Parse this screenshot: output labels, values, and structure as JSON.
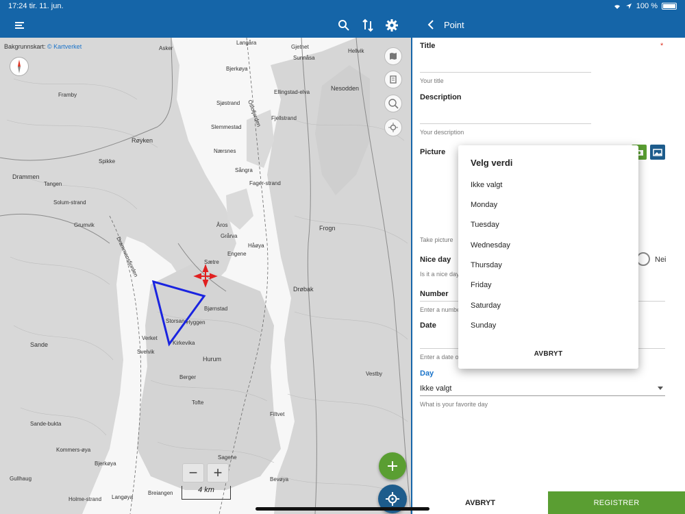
{
  "status_bar": {
    "time": "17:24",
    "date": "tir. 11. jun.",
    "battery": "100 %"
  },
  "map": {
    "attribution": "Bakgrunnskart:",
    "attribution_link": "© Kartverket",
    "scale_label": "4 km",
    "zoom_in": "+",
    "zoom_out": "−",
    "labels": [
      "Asker",
      "Langåra",
      "Gjetnet",
      "Hellvik",
      "Sunnåsa",
      "Nesodden",
      "Framby",
      "Bjerkøya",
      "Ellingstad-elva",
      "Sjøstrand",
      "Slemmestad",
      "Røyken",
      "Spikke",
      "Nærsnes",
      "Sångra",
      "Fjellstrand",
      "Drammen",
      "Tangen",
      "Solum-strand",
      "Fager-strand",
      "Frogn",
      "Åros",
      "Grårva",
      "Håøya",
      "Sætre",
      "Drøbak",
      "Verket",
      "Svelvik",
      "Sande",
      "Hurum",
      "Vestby",
      "Filtvet",
      "Sagene",
      "Bjerkøya",
      "Breiangen",
      "Holme-strand",
      "Langøya",
      "Bevøya",
      "Kommers-øya",
      "Gullhaug",
      "Sande-bukta",
      "Oslofjorden",
      "Drammensfjorden",
      "Storsand",
      "Kirkevika",
      "Berger",
      "Tofte",
      "Bjørnstad",
      "Grumvik",
      "Engene",
      "Hyggen"
    ],
    "toolbar_icons": [
      "menu-icon",
      "search-icon",
      "sort-icon",
      "gear-icon"
    ],
    "route_color": "#1a24e0",
    "target_color": "#e02020"
  },
  "form": {
    "header_title": "Point",
    "fields": {
      "title": {
        "label": "Title",
        "required_mark": "*",
        "help": "Your title"
      },
      "description": {
        "label": "Description",
        "help": "Your description"
      },
      "picture": {
        "label": "Picture",
        "help": "Take picture"
      },
      "nice_day": {
        "label": "Nice day",
        "help": "Is it a nice day",
        "option_no": "Nei"
      },
      "number": {
        "label": "Number",
        "help": "Enter a number"
      },
      "date": {
        "label": "Date",
        "help": "Enter a date of"
      },
      "day": {
        "label": "Day",
        "value": "Ikke valgt",
        "help": "What is your favorite day"
      }
    },
    "cancel_label": "AVBRYT",
    "register_label": "REGISTRER",
    "colors": {
      "primary": "#1565a8",
      "accent_green": "#5a9e32"
    }
  },
  "dialog": {
    "title": "Velg verdi",
    "options": [
      "Ikke valgt",
      "Monday",
      "Tuesday",
      "Wednesday",
      "Thursday",
      "Friday",
      "Saturday",
      "Sunday"
    ],
    "cancel_label": "AVBRYT"
  }
}
